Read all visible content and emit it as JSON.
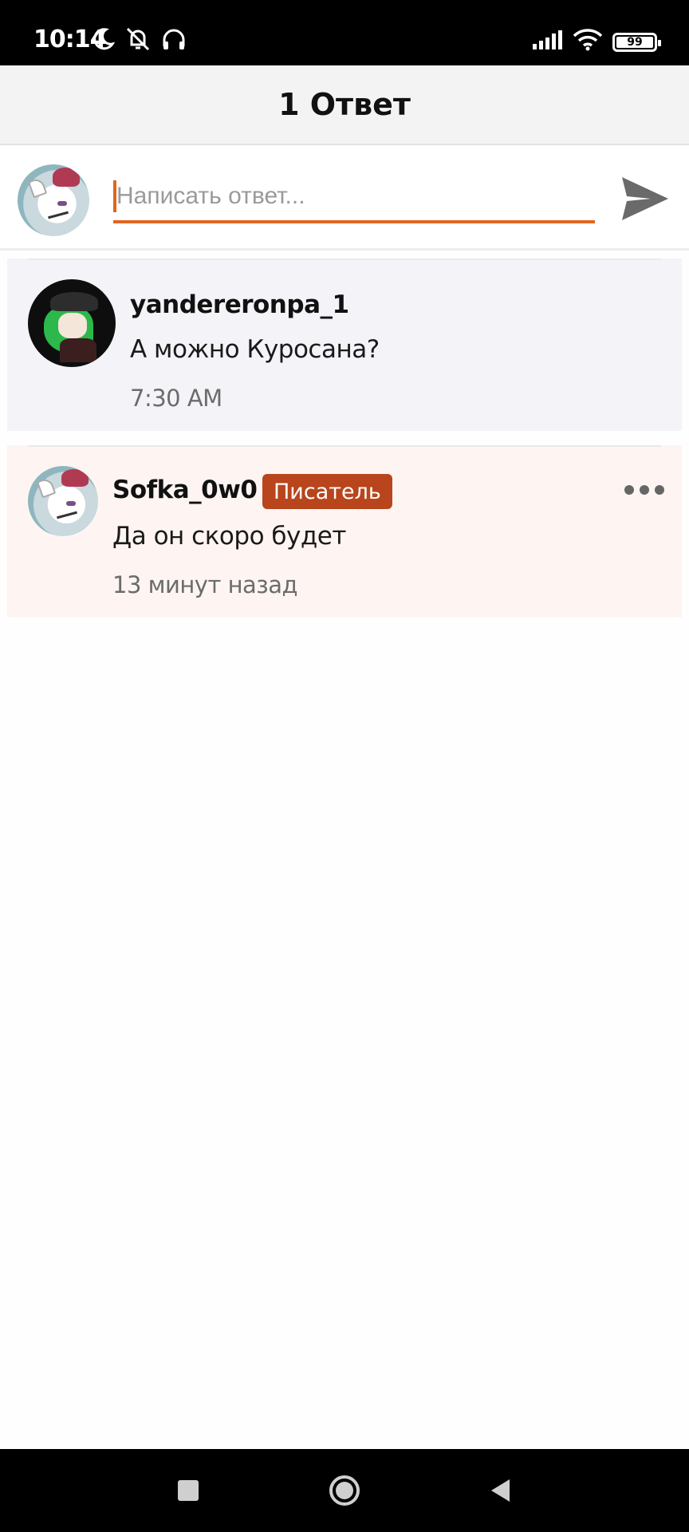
{
  "status_bar": {
    "time": "10:14",
    "battery": "99",
    "icons": [
      "moon-icon",
      "bell-off-icon",
      "headphones-icon",
      "signal-icon",
      "wifi-icon",
      "battery-icon"
    ]
  },
  "header": {
    "title": "1 Ответ"
  },
  "composer": {
    "placeholder": "Написать ответ...",
    "value": "",
    "send_icon": "send-icon",
    "accent_color": "#e0661f"
  },
  "comments": [
    {
      "author": "yandereronpa_1",
      "text": "А можно Куросана?",
      "time": "7:30 AM"
    },
    {
      "author": "Sofka_0w0",
      "badge": "Писатель",
      "text": "Да он скоро будет",
      "time": "13 минут назад",
      "badge_color": "#b9451c",
      "more_icon": "more-dots-icon"
    }
  ],
  "nav_bar": {
    "icons": [
      "recent-apps-icon",
      "home-icon",
      "back-icon"
    ]
  }
}
